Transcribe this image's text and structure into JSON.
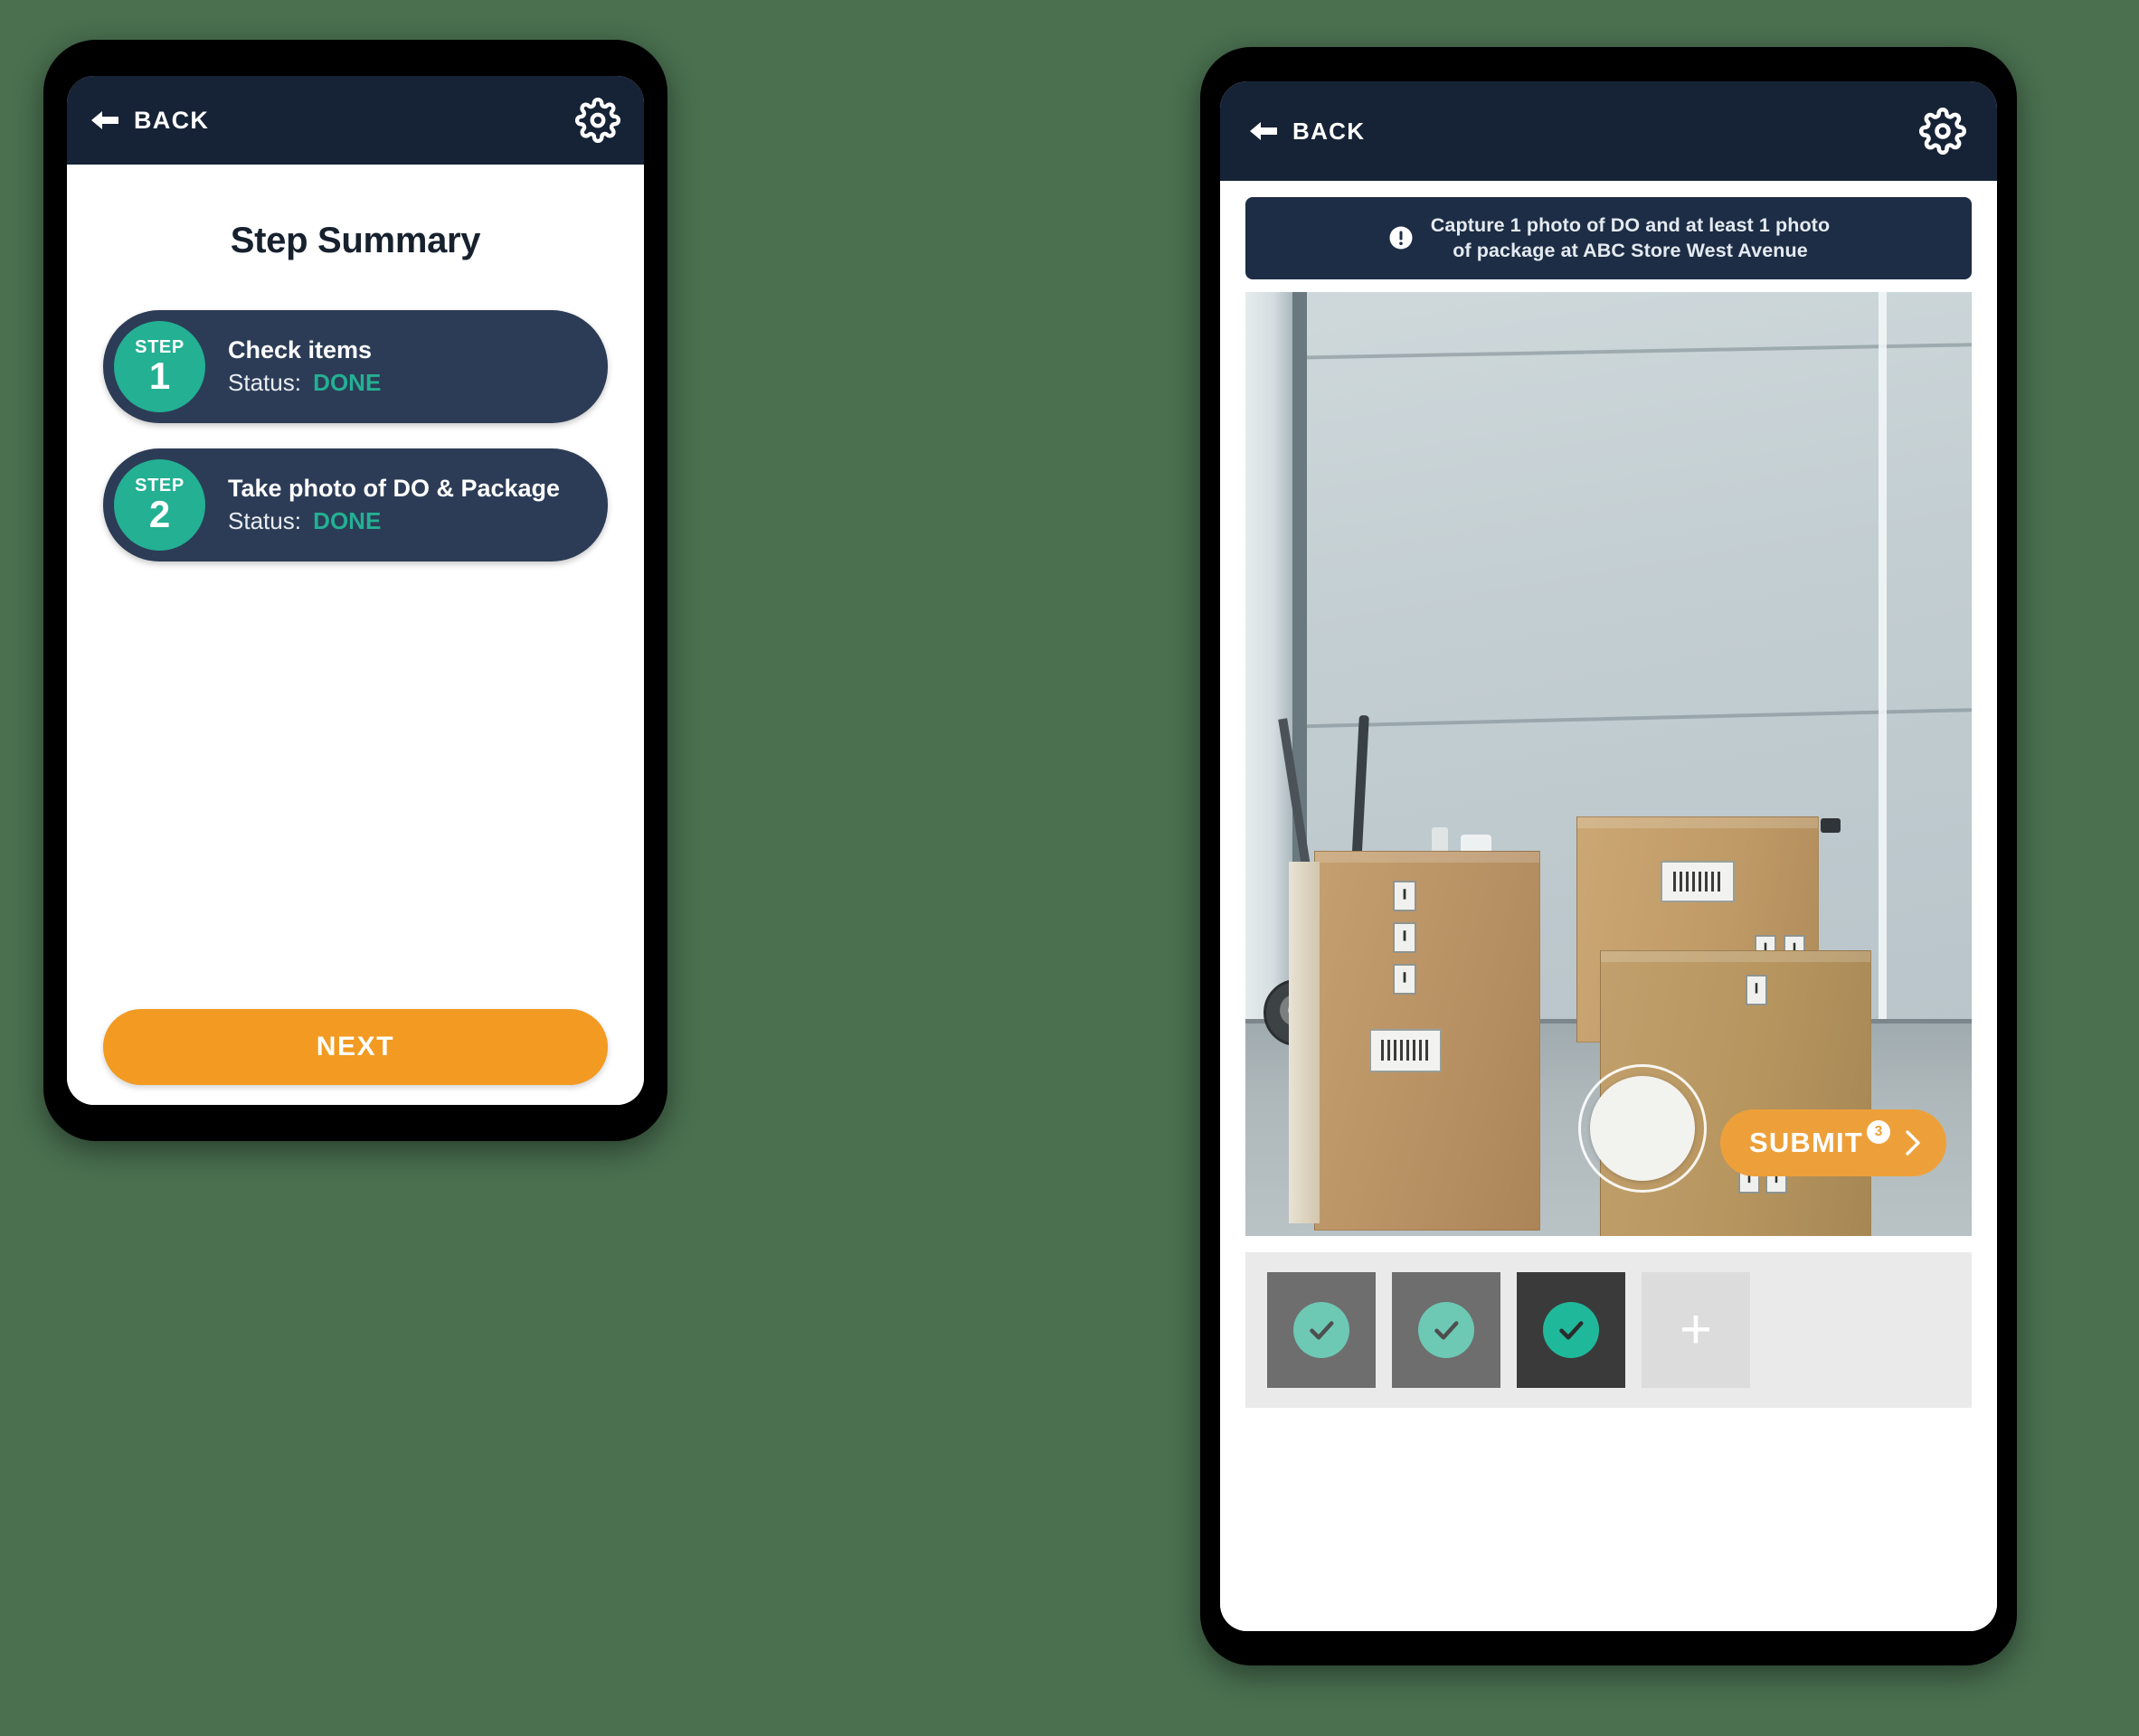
{
  "theme": {
    "page_background": "#4a7050",
    "header_navy": "#162336",
    "card_navy": "#2c3c56",
    "accent_teal": "#23b093",
    "accent_orange": "#f29a22",
    "submit_orange": "#eda03a"
  },
  "left_phone": {
    "header": {
      "back_label": "BACK",
      "back_icon": "arrow-left-icon",
      "settings_icon": "gear-icon"
    },
    "title": "Step Summary",
    "steps": [
      {
        "badge_word": "STEP",
        "badge_number": "1",
        "name": "Check items",
        "status_label": "Status:",
        "status_value": "DONE"
      },
      {
        "badge_word": "STEP",
        "badge_number": "2",
        "name": "Take photo of DO & Package",
        "status_label": "Status:",
        "status_value": "DONE"
      }
    ],
    "next_button": "NEXT"
  },
  "right_phone": {
    "header": {
      "back_label": "BACK",
      "back_icon": "arrow-left-icon",
      "settings_icon": "gear-icon"
    },
    "notice": {
      "icon": "alert-circle-icon",
      "line1": "Capture 1 photo of DO and at least 1 photo",
      "line2": "of package at ABC Store West Avenue"
    },
    "camera": {
      "shutter_icon": "camera-shutter-button",
      "submit_label": "SUBMIT",
      "submit_count": "3",
      "submit_chevron_icon": "chevron-right-icon"
    },
    "thumbnails": [
      {
        "icon": "check-circle-icon",
        "state": "captured"
      },
      {
        "icon": "check-circle-icon",
        "state": "captured"
      },
      {
        "icon": "check-circle-icon",
        "state": "selected"
      },
      {
        "icon": "plus-icon",
        "state": "add",
        "glyph": "+"
      }
    ]
  }
}
